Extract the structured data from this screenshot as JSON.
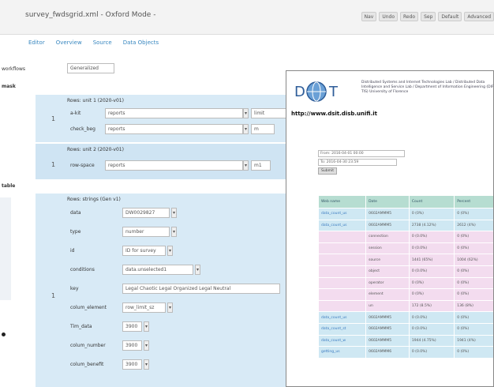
{
  "window": {
    "title": "survey_fwdsgrid.xml - Oxford Mode -"
  },
  "toolbar": {
    "buttons": [
      "Nav",
      "Undo",
      "Redo",
      "Sep",
      "Default",
      "Advanced"
    ]
  },
  "tabs": [
    "Editor",
    "Overview",
    "Source",
    "Data Objects"
  ],
  "editor": {
    "top_label": "workflows",
    "top_select": "Generalized",
    "section1": "mask",
    "section2": "table",
    "group1_title": "Rows: unit 1 (2020-v01)",
    "group1_index": "1",
    "group1_fields": [
      {
        "label": "a-kit",
        "value": "reports",
        "extra": "limit"
      },
      {
        "label": "check_beg",
        "value": "reports",
        "extra": "m"
      }
    ],
    "group2_title": "Rows: unit 2 (2020-v01)",
    "group2_index": "1",
    "group2_fields": [
      {
        "label": "row-space",
        "value": "reports",
        "extra": "m1"
      }
    ],
    "group3_title": "Rows: strings (Gen v1)",
    "group3_index": "1",
    "group3_fields": [
      {
        "label": "data",
        "value": "DW0029827"
      },
      {
        "label": "type",
        "value": "number"
      },
      {
        "label": "id",
        "value": "ID for survey"
      },
      {
        "label": "conditions",
        "value": "data.unselected1"
      },
      {
        "label": "key",
        "value": "Legal Chaotic Legal Organized Legal Neutral"
      },
      {
        "label": "colum_element",
        "value": "row_limit_sz"
      },
      {
        "label": "Tim_data",
        "value": "3900"
      },
      {
        "label": "colum_number",
        "value": "3900"
      },
      {
        "label": "colum_benefit",
        "value": "3900"
      }
    ]
  },
  "preview": {
    "logo_letters": "D  T",
    "org_text": "Distributed Systems and Internet Technologies Lab / Distributed Data Intelligence and Service Lab / Department of Information Engineering (DIP-TIS) University of Florence",
    "url": "http://www.dsit.disb.unifi.it",
    "form_lines": [
      "From: 2016-04-01 00:00",
      "To: 2016-04-30 23:59"
    ],
    "submit": "Submit",
    "table": {
      "headers": [
        "Web name",
        "Date",
        "Count",
        "Percent"
      ],
      "rows": [
        {
          "type": "blue",
          "cells": [
            "data_count_us",
            "0602AMMM5",
            "0 (0%)",
            "0 (0%)"
          ]
        },
        {
          "type": "blue",
          "cells": [
            "data_count_us",
            "0602AMMM5",
            "2738 (4.12%)",
            "2612 (4%)"
          ]
        },
        {
          "type": "pink",
          "cells": [
            "",
            "connection",
            "0 (0.0%)",
            "0 (0%)"
          ]
        },
        {
          "type": "pink",
          "cells": [
            "",
            "session",
            "0 (0.0%)",
            "0 (0%)"
          ]
        },
        {
          "type": "pink",
          "cells": [
            "",
            "source",
            "1441 (65%)",
            "1004 (62%)"
          ]
        },
        {
          "type": "pink",
          "cells": [
            "",
            "object",
            "0 (0.0%)",
            "0 (0%)"
          ]
        },
        {
          "type": "pink",
          "cells": [
            "",
            "operator",
            "0 (0%)",
            "0 (0%)"
          ]
        },
        {
          "type": "pink",
          "cells": [
            "",
            "element",
            "0 (0%)",
            "0 (0%)"
          ]
        },
        {
          "type": "pink",
          "cells": [
            "",
            "un",
            "172 (8.5%)",
            "136 (8%)"
          ]
        },
        {
          "type": "blue",
          "cells": [
            "data_count_us",
            "0602AMMM5",
            "0 (0.0%)",
            "0 (0%)"
          ]
        },
        {
          "type": "blue",
          "cells": [
            "data_count_st",
            "0602AMMM5",
            "0 (0.0%)",
            "0 (0%)"
          ]
        },
        {
          "type": "blue",
          "cells": [
            "data_count_w",
            "0602AMMM5",
            "1944 (4.75%)",
            "1941 (4%)"
          ]
        },
        {
          "type": "blue",
          "cells": [
            "getting_us",
            "0602AMMM6",
            "0 (0.0%)",
            "0 (0%)"
          ]
        }
      ]
    }
  }
}
